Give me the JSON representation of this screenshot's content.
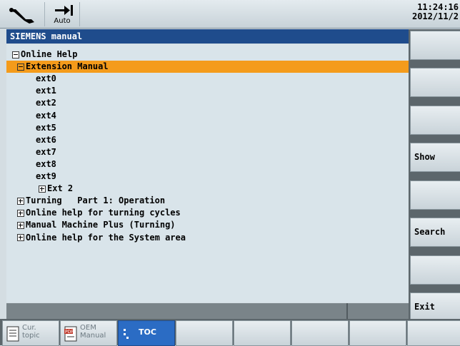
{
  "header": {
    "tool_icon": "wrench-icon",
    "mode_icon": "arrow-to-bar-icon",
    "mode_label": "Auto",
    "time": "11:24:16",
    "date": "2012/11/2"
  },
  "title": "SIEMENS manual",
  "tree": [
    {
      "label": "Online Help",
      "expander": "minus",
      "level": 0,
      "selected": false
    },
    {
      "label": "Extension Manual",
      "expander": "minus",
      "level": 1,
      "selected": true
    },
    {
      "label": "ext0",
      "expander": "",
      "level": 2,
      "selected": false
    },
    {
      "label": "ext1",
      "expander": "",
      "level": 2,
      "selected": false
    },
    {
      "label": "ext2",
      "expander": "",
      "level": 2,
      "selected": false
    },
    {
      "label": "ext4",
      "expander": "",
      "level": 2,
      "selected": false
    },
    {
      "label": "ext5",
      "expander": "",
      "level": 2,
      "selected": false
    },
    {
      "label": "ext6",
      "expander": "",
      "level": 2,
      "selected": false
    },
    {
      "label": "ext7",
      "expander": "",
      "level": 2,
      "selected": false
    },
    {
      "label": "ext8",
      "expander": "",
      "level": 2,
      "selected": false
    },
    {
      "label": "ext9",
      "expander": "",
      "level": 2,
      "selected": false
    },
    {
      "label": "Ext 2",
      "expander": "plus",
      "level": 3,
      "selected": false
    },
    {
      "label": "Turning   Part 1: Operation",
      "expander": "plus",
      "level": 1,
      "selected": false
    },
    {
      "label": "Online help for turning cycles",
      "expander": "plus",
      "level": 1,
      "selected": false
    },
    {
      "label": "Manual Machine Plus (Turning)",
      "expander": "plus",
      "level": 1,
      "selected": false
    },
    {
      "label": "Online help for the System area",
      "expander": "plus",
      "level": 1,
      "selected": false
    }
  ],
  "softkeys": [
    "",
    "",
    "",
    "Show",
    "",
    "Search",
    "",
    "Exit"
  ],
  "bottom_tabs": [
    {
      "label": "Cur.\ntopic",
      "icon": "document-icon",
      "active": false
    },
    {
      "label": "OEM\nManual",
      "icon": "pdf-document-icon",
      "active": false
    },
    {
      "label": "TOC",
      "icon": "toc-list-icon",
      "active": true
    },
    {
      "label": "",
      "icon": "",
      "active": false
    },
    {
      "label": "",
      "icon": "",
      "active": false
    },
    {
      "label": "",
      "icon": "",
      "active": false
    },
    {
      "label": "",
      "icon": "",
      "active": false
    },
    {
      "label": "",
      "icon": "",
      "active": false
    }
  ],
  "colors": {
    "title_bar": "#1f4c8c",
    "selection": "#f49b1b",
    "active_tab": "#2b6cc4",
    "panel": "#d9e4ea"
  }
}
